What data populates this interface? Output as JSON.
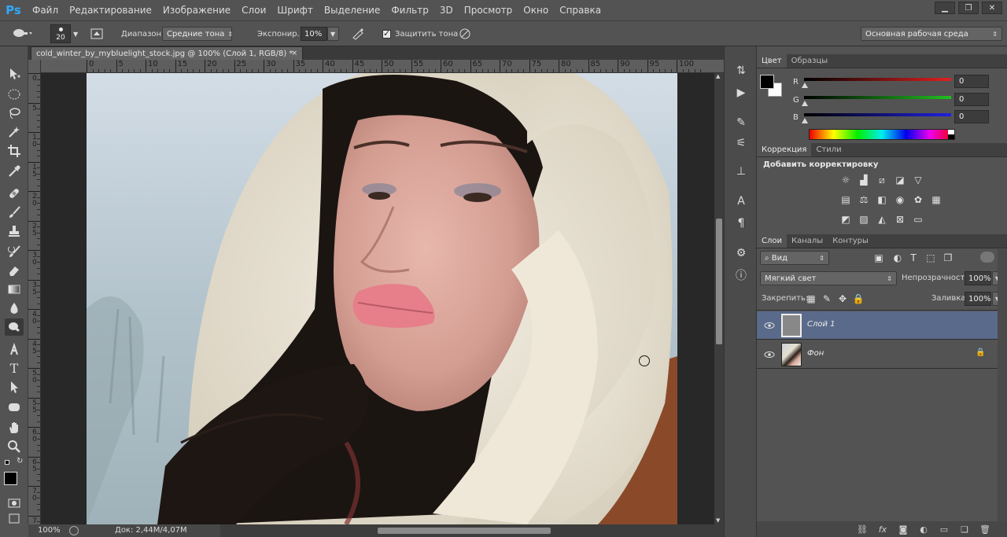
{
  "menu": {
    "logo": "Ps",
    "items": [
      "Файл",
      "Редактирование",
      "Изображение",
      "Слои",
      "Шрифт",
      "Выделение",
      "Фильтр",
      "3D",
      "Просмотр",
      "Окно",
      "Справка"
    ]
  },
  "options": {
    "brush_size": "20",
    "range_label": "Диапазон:",
    "range_value": "Средние тона",
    "exposure_label": "Экспонир.:",
    "exposure_value": "10%",
    "protect_tones_label": "Защитить тона",
    "workspace": "Основная рабочая среда"
  },
  "document": {
    "tab_title": "cold_winter_by_mybluelight_stock.jpg @ 100% (Слой 1, RGB/8) *",
    "tab_close": "×",
    "zoom": "100%",
    "doc_info": "Док: 2,44M/4,07M"
  },
  "ruler_top_labels": [
    "0",
    "5",
    "10",
    "15",
    "20",
    "25",
    "30",
    "35",
    "40",
    "45",
    "50",
    "55",
    "60",
    "65",
    "70",
    "75",
    "80",
    "85",
    "90",
    "95",
    "100"
  ],
  "ruler_left_labels": [
    "0",
    "5",
    "1\n0",
    "1\n5",
    "2\n0",
    "2\n5",
    "3\n0",
    "3\n5",
    "4\n0",
    "4\n5",
    "5\n0",
    "5\n5",
    "6\n0",
    "6\n5",
    "7\n0",
    "7\n5"
  ],
  "color_panel": {
    "tabs": [
      "Цвет",
      "Образцы"
    ],
    "sliders": [
      {
        "label": "R",
        "value": "0",
        "color": "#e02020"
      },
      {
        "label": "G",
        "value": "0",
        "color": "#20c020"
      },
      {
        "label": "B",
        "value": "0",
        "color": "#2020e0"
      }
    ]
  },
  "adjustments_panel": {
    "tabs": [
      "Коррекция",
      "Стили"
    ],
    "heading": "Добавить корректировку"
  },
  "layers_panel": {
    "tabs": [
      "Слои",
      "Каналы",
      "Контуры"
    ],
    "filter_kind": "Вид",
    "blend_mode": "Мягкий свет",
    "opacity_label": "Непрозрачность:",
    "opacity_value": "100%",
    "lock_label": "Закрепить:",
    "fill_label": "Заливка:",
    "fill_value": "100%",
    "layers": [
      {
        "name": "Слой 1",
        "selected": true
      },
      {
        "name": "Фон",
        "selected": false,
        "locked": true
      }
    ]
  },
  "colors": {
    "accent": "#31a8ff",
    "selected_layer": "#5a6a8a",
    "panel": "#535353"
  }
}
